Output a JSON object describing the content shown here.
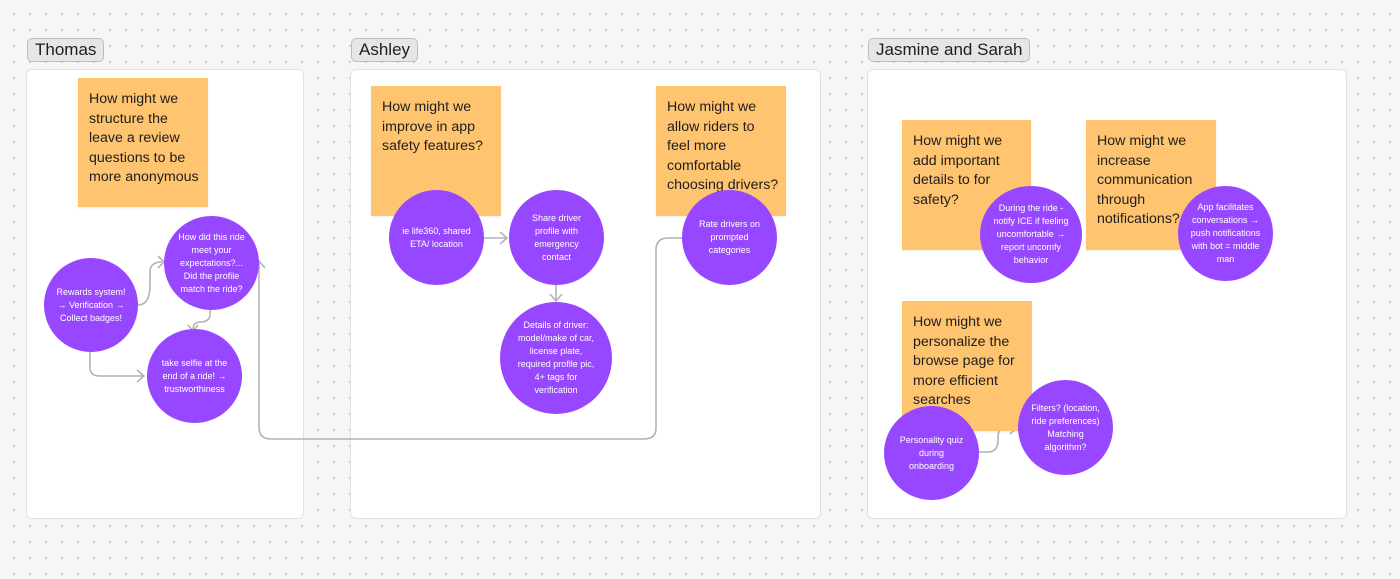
{
  "sections": [
    {
      "name": "Thomas",
      "stickies": [
        "How might we structure the leave a review questions to be more anonymous"
      ],
      "circles": [
        "How did this ride meet your expectations?... Did the profile match the ride?",
        "Rewards system! → Verification → Collect badges!",
        "take selfie at the end of a ride! → trustworthiness"
      ]
    },
    {
      "name": "Ashley",
      "stickies": [
        "How might we improve in app safety features?",
        "How might we allow riders to feel more comfortable choosing drivers?"
      ],
      "circles": [
        "ie life360, shared ETA/ location",
        "Share driver profile with emergency contact",
        "Details of driver: model/make of car, license plate, required profile pic, 4+ tags for verification",
        "Rate drivers on prompted categories"
      ]
    },
    {
      "name": "Jasmine and Sarah",
      "stickies": [
        "How might we add important details to for safety?",
        "How might we increase communication through notifications?",
        "How might we personalize the browse page for more efficient searches"
      ],
      "circles": [
        "During the ride - notify ICE if feeling uncomfortable → report uncomfy behavior",
        "App facilitates conversations → push notifications with bot = middle man",
        "Personality quiz during onboarding",
        "Filters? (location, ride preferences) Matching algorithm?"
      ]
    }
  ],
  "colors": {
    "sticky": "#ffc470",
    "circle": "#9747ff",
    "connector": "#b3b3b3",
    "canvas": "#f6f6f6"
  }
}
